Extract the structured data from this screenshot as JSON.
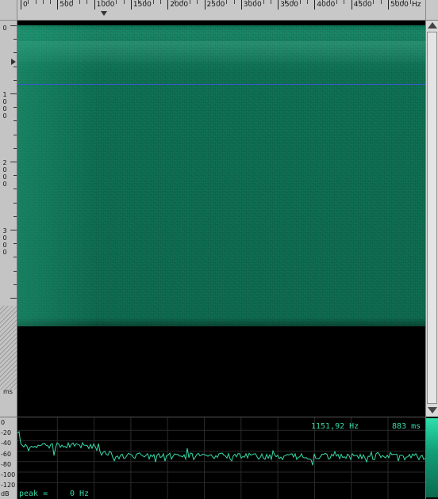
{
  "frequency_ruler": {
    "labels": [
      "0",
      "500",
      "1000",
      "1500",
      "2000",
      "2500",
      "3000",
      "3500",
      "4000",
      "4500",
      "5000"
    ],
    "unit": "Hz"
  },
  "time_ruler": {
    "labels": [
      [
        "0"
      ],
      [
        "1",
        "0",
        "0",
        "0"
      ],
      [
        "2",
        "0",
        "0",
        "0"
      ],
      [
        "3",
        "0",
        "0",
        "0"
      ]
    ],
    "unit": "ms"
  },
  "spectrum_readout": {
    "frequency": "1151,92 Hz",
    "time": "883 ms",
    "peak_label": "peak =",
    "peak_value": "0 Hz"
  },
  "db_scale": {
    "labels": [
      "0",
      "-20",
      "-40",
      "-60",
      "-80",
      "-100",
      "-120"
    ],
    "unit": "dB"
  },
  "colors": {
    "spectrogram": "#0f7354",
    "cursor": "#3a5bd0",
    "trace": "#36d9a8"
  }
}
